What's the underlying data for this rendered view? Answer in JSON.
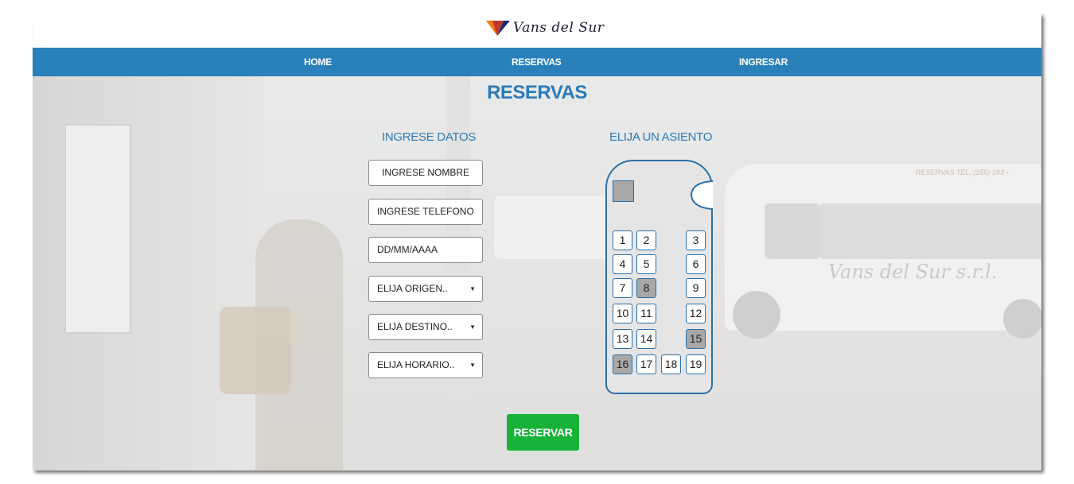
{
  "brand": {
    "logo_text": "Vans del Sur",
    "accent": "#2a80b9"
  },
  "nav": {
    "home": "HOME",
    "reservas": "RESERVAS",
    "ingresar": "INGRESAR"
  },
  "main": {
    "title": "RESERVAS",
    "form_heading": "INGRESE DATOS",
    "seat_heading": "ELIJA UN ASIENTO",
    "fields": {
      "nombre": "INGRESE NOMBRE",
      "telefono": "INGRESE TELEFONO",
      "fecha": "DD/MM/AAAA",
      "origen": "ELIJA ORIGEN..",
      "destino": "ELIJA DESTINO..",
      "horario": "ELIJA HORARIO.."
    },
    "submit": "RESERVAR"
  },
  "background_text": {
    "van_brand": "Vans del Sur s.r.l.",
    "van_phone": "RESERVAS TEL.:(155) 183 -"
  },
  "seats": [
    {
      "n": "1",
      "taken": false
    },
    {
      "n": "2",
      "taken": false
    },
    {
      "n": "3",
      "taken": false
    },
    {
      "n": "4",
      "taken": false
    },
    {
      "n": "5",
      "taken": false
    },
    {
      "n": "6",
      "taken": false
    },
    {
      "n": "7",
      "taken": false
    },
    {
      "n": "8",
      "taken": true
    },
    {
      "n": "9",
      "taken": false
    },
    {
      "n": "10",
      "taken": false
    },
    {
      "n": "11",
      "taken": false
    },
    {
      "n": "12",
      "taken": false
    },
    {
      "n": "13",
      "taken": false
    },
    {
      "n": "14",
      "taken": false
    },
    {
      "n": "15",
      "taken": true
    },
    {
      "n": "16",
      "taken": true
    },
    {
      "n": "17",
      "taken": false
    },
    {
      "n": "18",
      "taken": false
    },
    {
      "n": "19",
      "taken": false
    }
  ]
}
